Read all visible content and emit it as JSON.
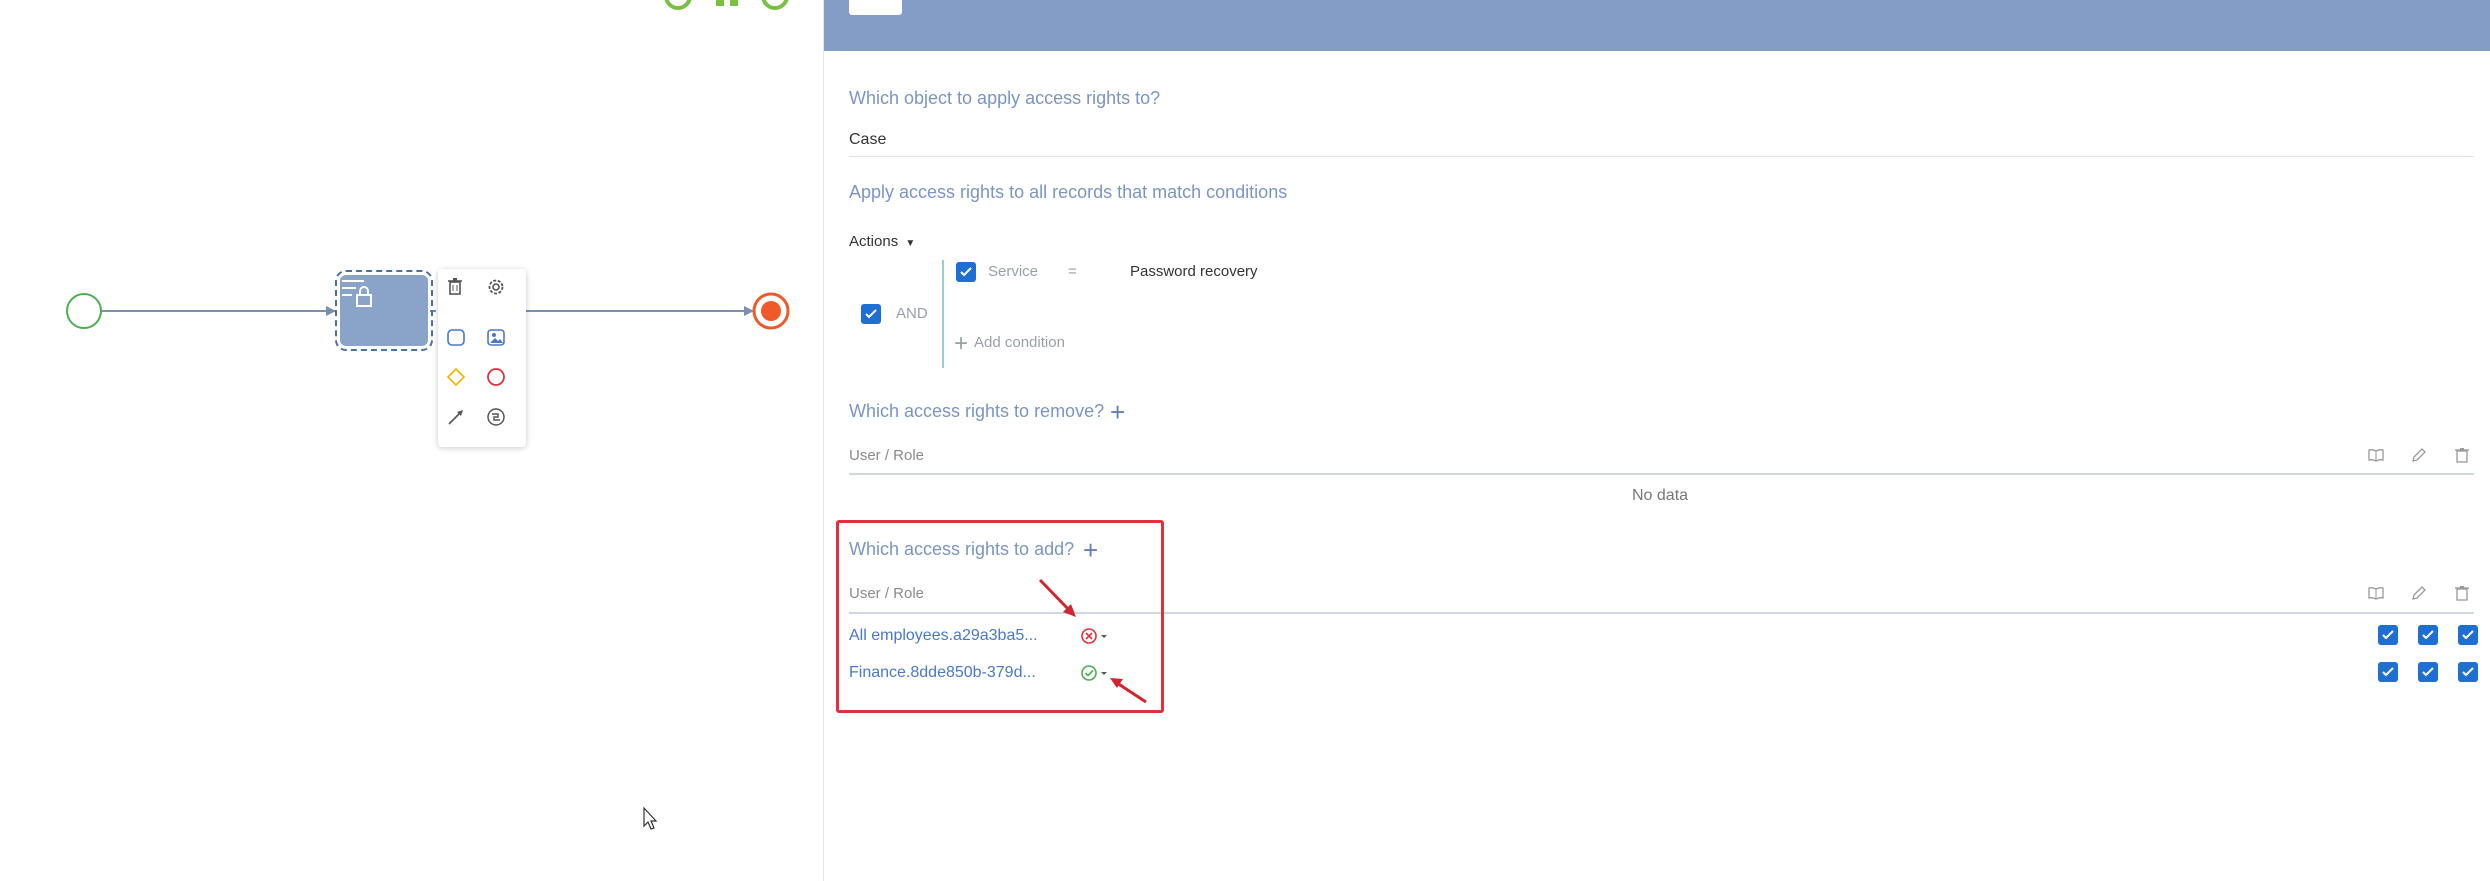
{
  "designer": {
    "toolbox_items": [
      "delete",
      "settings",
      "user-task",
      "image-task",
      "gateway",
      "end-event",
      "connector",
      "subprocess"
    ]
  },
  "panel": {
    "object_question": "Which object to apply access rights to?",
    "object_value": "Case",
    "conditions_question": "Apply access rights to all records that match conditions",
    "actions_label": "Actions",
    "and_label": "AND",
    "condition": {
      "field": "Service",
      "operator": "=",
      "value": "Password recovery"
    },
    "add_condition": "Add condition",
    "remove_question": "Which access rights to remove?",
    "remove_table": {
      "column": "User / Role",
      "empty": "No data"
    },
    "add_question": "Which access rights to add?",
    "add_table": {
      "column": "User / Role",
      "rows": [
        {
          "name": "All employees.a29a3ba5...",
          "status": "deny"
        },
        {
          "name": "Finance.8dde850b-379d...",
          "status": "allow"
        }
      ]
    }
  },
  "colors": {
    "header": "#849dc6",
    "accent": "#1e6fd2",
    "highlight": "#e0303a",
    "start": "#4caf50",
    "end": "#f05a28"
  }
}
